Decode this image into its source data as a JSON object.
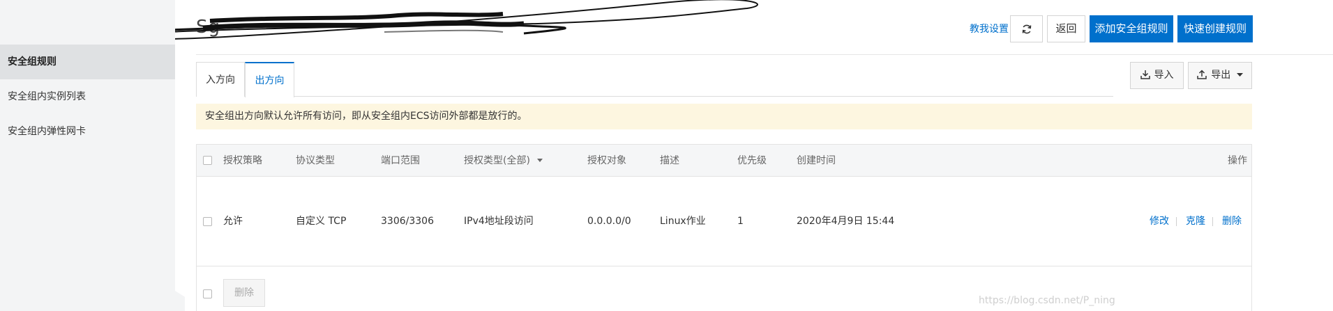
{
  "sidebar": {
    "items": [
      {
        "label": "安全组规则",
        "active": true
      },
      {
        "label": "安全组内实例列表",
        "active": false
      },
      {
        "label": "安全组内弹性网卡",
        "active": false
      }
    ]
  },
  "header": {
    "title_fragment": "Sg-",
    "help_link": "教我设置",
    "back_label": "返回",
    "add_rule_label": "添加安全组规则",
    "quick_create_label": "快速创建规则"
  },
  "tabs": [
    {
      "label": "入方向",
      "active": false
    },
    {
      "label": "出方向",
      "active": true
    }
  ],
  "toolbar": {
    "import_label": "导入",
    "export_label": "导出"
  },
  "notice": "安全组出方向默认允许所有访问，即从安全组内ECS访问外部都是放行的。",
  "table": {
    "columns": [
      "授权策略",
      "协议类型",
      "端口范围",
      "授权类型(全部)",
      "授权对象",
      "描述",
      "优先级",
      "创建时间",
      "操作"
    ],
    "rows": [
      {
        "policy": "允许",
        "protocol": "自定义 TCP",
        "port_range": "3306/3306",
        "auth_type": "IPv4地址段访问",
        "auth_object": "0.0.0.0/0",
        "description": "Linux作业",
        "priority": "1",
        "created": "2020年4月9日 15:44",
        "actions": [
          "修改",
          "克隆",
          "删除"
        ]
      }
    ],
    "bulk_delete_label": "删除"
  },
  "watermark": "https://blog.csdn.net/P_ning",
  "colors": {
    "accent": "#0070cc",
    "notice_bg": "#fdf6e0",
    "sidebar_bg": "#f3f4f5",
    "sidebar_active_bg": "#dfe1e3"
  }
}
